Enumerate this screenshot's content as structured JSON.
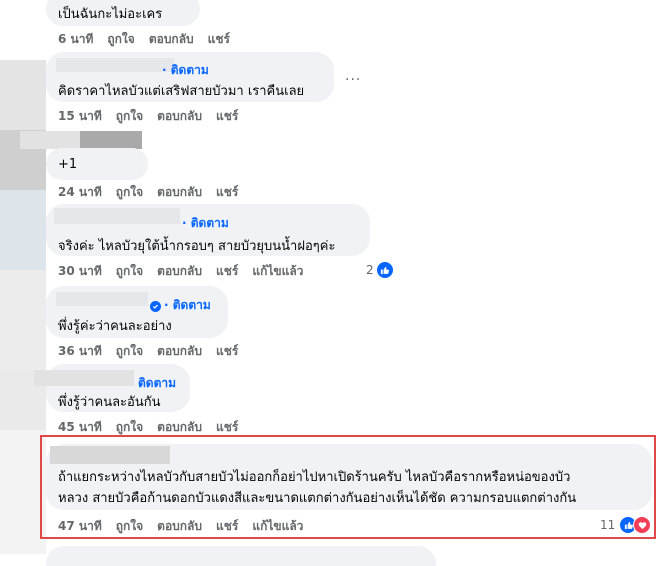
{
  "comments": [
    {
      "text": "เป็นฉันกะไม่อะเคร",
      "time": "6 นาที",
      "like": "ถูกใจ",
      "reply": "ตอบกลับ",
      "share": "แชร์"
    },
    {
      "follow": "ติดตาม",
      "text": "คิดราคาไหลบัวแต่เสริฟสายบัวมา เราคืนเลย",
      "time": "15 นาที",
      "like": "ถูกใจ",
      "reply": "ตอบกลับ",
      "share": "แชร์",
      "more": "..."
    },
    {
      "text": "+1",
      "time": "24 นาที",
      "like": "ถูกใจ",
      "reply": "ตอบกลับ",
      "share": "แชร์"
    },
    {
      "follow": "ติดตาม",
      "text": "จริงค่ะ ไหลบัวยุใต้น้ำกรอบๆ สายบัวยุบนน้ำฝอๆค่ะ",
      "time": "30 นาที",
      "like": "ถูกใจ",
      "reply": "ตอบกลับ",
      "share": "แชร์",
      "edited": "แก้ไขแล้ว",
      "reactions": "2"
    },
    {
      "follow": "ติดตาม",
      "text": "พึ่งรู้ค่ะว่าคนละอย่าง",
      "time": "36 นาที",
      "like": "ถูกใจ",
      "reply": "ตอบกลับ",
      "share": "แชร์"
    },
    {
      "follow": "ติดตาม",
      "text": "พึ่งรู้ว่าคนละอันกัน",
      "time": "45 นาที",
      "like": "ถูกใจ",
      "reply": "ตอบกลับ",
      "share": "แชร์"
    },
    {
      "text_line1": "ถ้าแยกระหว่างไหลบัวกับสายบัวไม่ออกก็อย่าไปหาเปิดร้านครับ ไหลบัวคือรากหรือหน่อของบัว",
      "text_line2": "หลวง สายบัวคือก้านดอกบัวแดงสีและขนาดแตกต่างกันอย่างเห็นได้ชัด ความกรอบแตกต่างกัน",
      "time": "47 นาที",
      "like": "ถูกใจ",
      "reply": "ตอบกลับ",
      "share": "แชร์",
      "edited": "แก้ไขแล้ว",
      "reactions": "11"
    }
  ],
  "colors": {
    "bubble": "#f0f2f5",
    "accent": "#0866ff",
    "meta": "#65676b",
    "highlight": "#e04848",
    "heart": "#f33e58"
  }
}
